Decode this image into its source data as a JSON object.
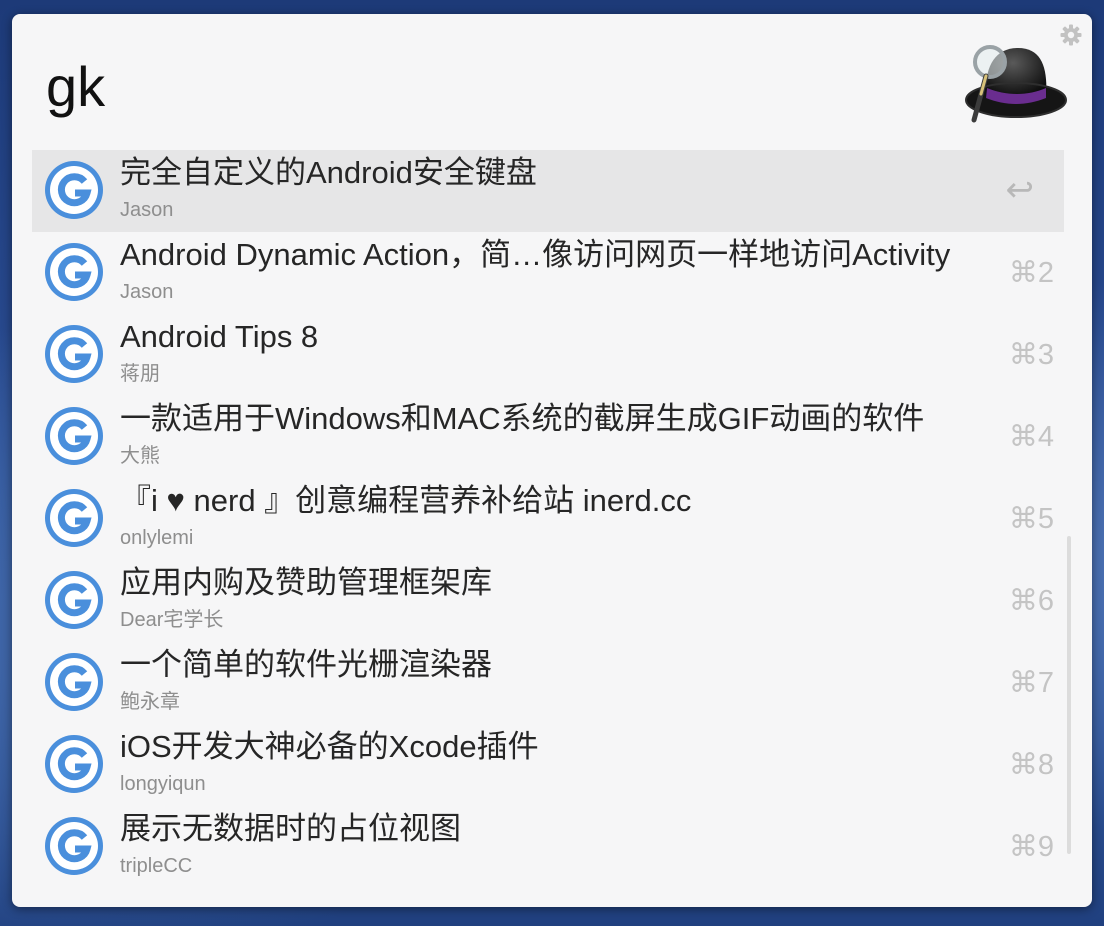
{
  "search": {
    "query": "gk"
  },
  "icons": {
    "settings": "gear-icon",
    "app_logo": "alfred-hat-logo",
    "result": "g-letter-icon",
    "enter": "return-arrow-icon"
  },
  "colors": {
    "accent_blue": "#4a8fdc",
    "selected_row": "#e6e6e7"
  },
  "results": [
    {
      "title": "完全自定义的Android安全键盘",
      "subtitle": "Jason",
      "shortcut": "↩"
    },
    {
      "title": "Android Dynamic Action，简…像访问网页一样地访问Activity",
      "subtitle": "Jason",
      "shortcut": "⌘2"
    },
    {
      "title": "Android Tips 8",
      "subtitle": "蒋朋",
      "shortcut": "⌘3"
    },
    {
      "title": "一款适用于Windows和MAC系统的截屏生成GIF动画的软件",
      "subtitle": "大熊",
      "shortcut": "⌘4"
    },
    {
      "title": "『i ♥ nerd 』创意编程营养补给站 inerd.cc",
      "subtitle": "onlylemi",
      "shortcut": "⌘5"
    },
    {
      "title": "应用内购及赞助管理框架库",
      "subtitle": "Dear宅学长",
      "shortcut": "⌘6"
    },
    {
      "title": "一个简单的软件光栅渲染器",
      "subtitle": "鲍永章",
      "shortcut": "⌘7"
    },
    {
      "title": "iOS开发大神必备的Xcode插件",
      "subtitle": "longyiqun",
      "shortcut": "⌘8"
    },
    {
      "title": "展示无数据时的占位视图",
      "subtitle": "tripleCC",
      "shortcut": "⌘9"
    }
  ]
}
